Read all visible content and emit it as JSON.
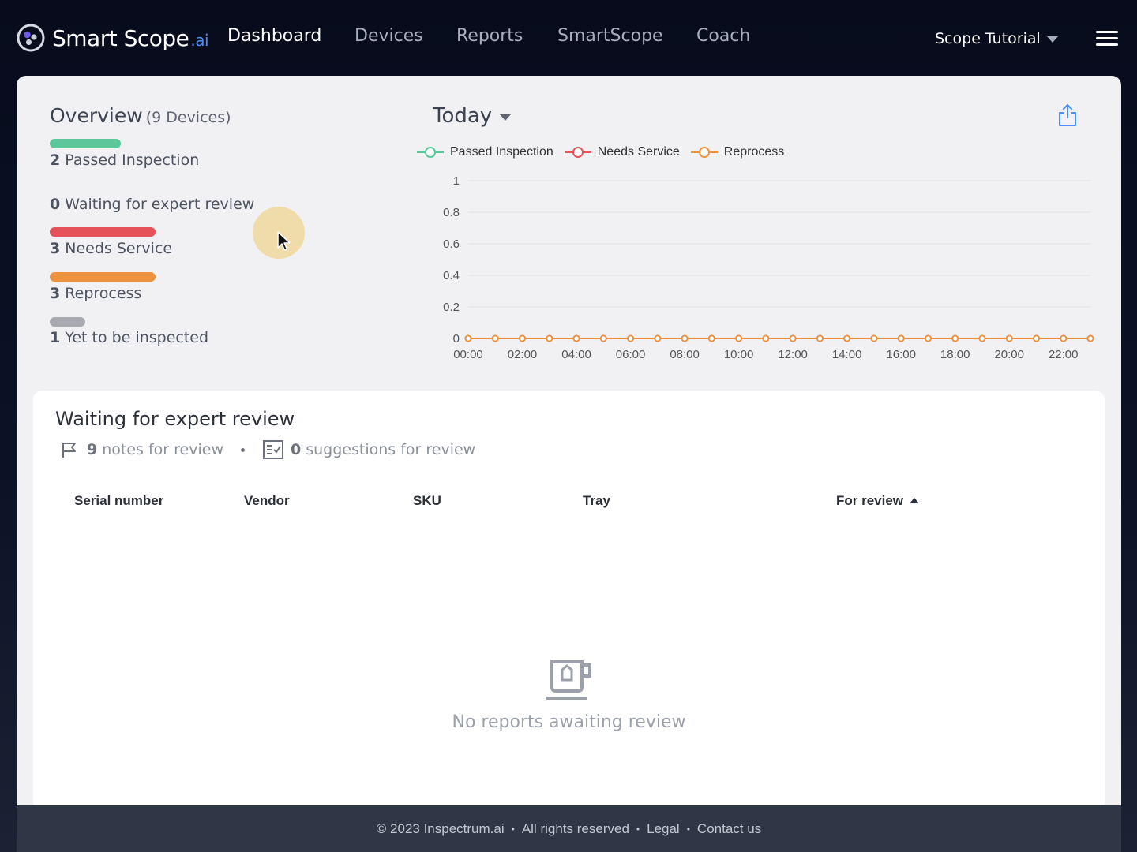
{
  "brand": {
    "name": "Smart Scope",
    "suffix": ".ai"
  },
  "nav": {
    "items": [
      {
        "label": "Dashboard",
        "active": true
      },
      {
        "label": "Devices"
      },
      {
        "label": "Reports"
      },
      {
        "label": "SmartScope"
      },
      {
        "label": "Coach"
      }
    ],
    "account_label": "Scope Tutorial"
  },
  "overview": {
    "title": "Overview",
    "subtitle": "(9 Devices)",
    "stats": [
      {
        "count": "2",
        "label": "Passed Inspection",
        "color": "#5cc79b",
        "value": 2
      },
      {
        "count": "0",
        "label": "Waiting for expert review",
        "color": "#4d8df7",
        "value": 0
      },
      {
        "count": "3",
        "label": "Needs Service",
        "color": "#e5525a",
        "value": 3
      },
      {
        "count": "3",
        "label": "Reprocess",
        "color": "#ef923d",
        "value": 3
      },
      {
        "count": "1",
        "label": "Yet to be inspected",
        "color": "#a8aab0",
        "value": 1
      }
    ]
  },
  "period": {
    "label": "Today"
  },
  "chart_data": {
    "type": "line",
    "x": [
      "00:00",
      "01:00",
      "02:00",
      "03:00",
      "04:00",
      "05:00",
      "06:00",
      "07:00",
      "08:00",
      "09:00",
      "10:00",
      "11:00",
      "12:00",
      "13:00",
      "14:00",
      "15:00",
      "16:00",
      "17:00",
      "18:00",
      "19:00",
      "20:00",
      "21:00",
      "22:00",
      "23:00"
    ],
    "tick_labels": [
      "00:00",
      "02:00",
      "04:00",
      "06:00",
      "08:00",
      "10:00",
      "12:00",
      "14:00",
      "16:00",
      "18:00",
      "20:00",
      "22:00"
    ],
    "y_ticks": [
      "0",
      "0.2",
      "0.4",
      "0.6",
      "0.8",
      "1"
    ],
    "ylim": [
      0,
      1
    ],
    "grid": true,
    "legend": "top-left",
    "series": [
      {
        "name": "Passed Inspection",
        "color": "#5cc79b",
        "values": [
          0,
          0,
          0,
          0,
          0,
          0,
          0,
          0,
          0,
          0,
          0,
          0,
          0,
          0,
          0,
          0,
          0,
          0,
          0,
          0,
          0,
          0,
          0,
          0
        ]
      },
      {
        "name": "Needs Service",
        "color": "#e5525a",
        "values": [
          0,
          0,
          0,
          0,
          0,
          0,
          0,
          0,
          0,
          0,
          0,
          0,
          0,
          0,
          0,
          0,
          0,
          0,
          0,
          0,
          0,
          0,
          0,
          0
        ]
      },
      {
        "name": "Reprocess",
        "color": "#ef923d",
        "values": [
          0,
          0,
          0,
          0,
          0,
          0,
          0,
          0,
          0,
          0,
          0,
          0,
          0,
          0,
          0,
          0,
          0,
          0,
          0,
          0,
          0,
          0,
          0,
          0
        ]
      }
    ]
  },
  "review": {
    "title": "Waiting for expert review",
    "notes_count": "9",
    "notes_label": "notes for review",
    "suggestions_count": "0",
    "suggestions_label": "suggestions for review",
    "columns": [
      "Serial number",
      "Vendor",
      "SKU",
      "Tray",
      "For review"
    ],
    "empty_text": "No reports awaiting review"
  },
  "footer": {
    "copyright": "© 2023 Inspectrum.ai",
    "rights": "All rights reserved",
    "legal": "Legal",
    "contact": "Contact us"
  }
}
